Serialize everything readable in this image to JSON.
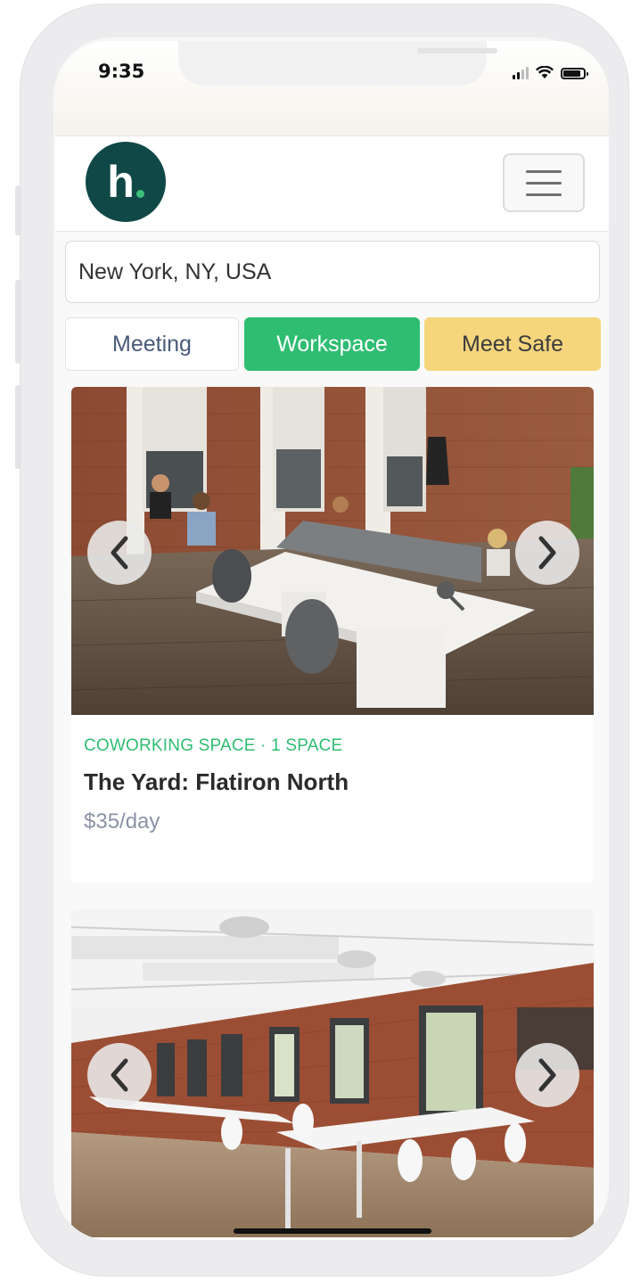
{
  "status_bar": {
    "time": "9:35"
  },
  "header": {
    "logo_text": "h",
    "logo_dot_color": "#3cc17a",
    "logo_bg": "#0f4846"
  },
  "search": {
    "value": "New York, NY, USA"
  },
  "tabs": [
    {
      "label": "Meeting",
      "selected": false
    },
    {
      "label": "Workspace",
      "selected": true,
      "color": "#2fbd72"
    },
    {
      "label": "Meet Safe",
      "selected": false,
      "color": "#f5d67c"
    }
  ],
  "listings": [
    {
      "meta": "COWORKING SPACE · 1 SPACE",
      "title": "The Yard: Flatiron North",
      "price": "$35/day",
      "image": "coworking-office-photo"
    },
    {
      "image": "loft-office-photo"
    }
  ],
  "icons": {
    "prev": "chevron-left-icon",
    "next": "chevron-right-icon",
    "menu": "hamburger-icon"
  }
}
